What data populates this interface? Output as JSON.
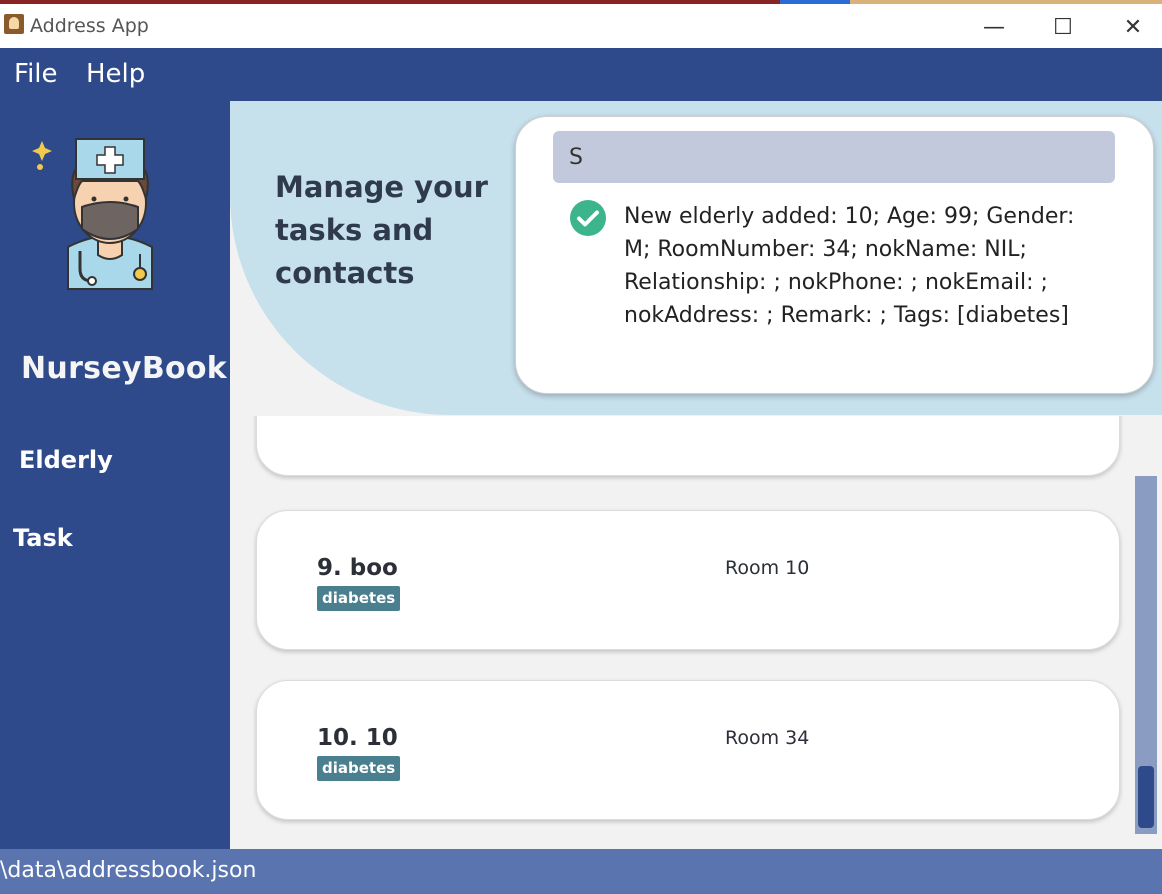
{
  "window": {
    "title": "Address App",
    "minimize_glyph": "—",
    "maximize_glyph": "☐",
    "close_glyph": "✕"
  },
  "menu": {
    "items": [
      {
        "label": "File"
      },
      {
        "label": "Help"
      }
    ]
  },
  "sidebar": {
    "brand": "NurseyBook",
    "avatar_icon": "nurse-avatar-icon",
    "nav": [
      {
        "label": "Elderly"
      },
      {
        "label": "Task"
      }
    ]
  },
  "header": {
    "tagline": "Manage your tasks and contacts"
  },
  "command": {
    "input_value": "S",
    "result_icon": "check-circle-icon",
    "result_text": "New elderly added: 10; Age: 99; Gender: M; RoomNumber: 34; nokName: NIL; Relationship: ; nokPhone: ; nokEmail: ; nokAddress: ; Remark: ; Tags: [diabetes]"
  },
  "elderly_list": [
    {
      "name": "9. boo",
      "tag": "diabetes",
      "room": "Room 10"
    },
    {
      "name": "10. 10",
      "tag": "diabetes",
      "room": "Room 34"
    }
  ],
  "status": {
    "path": "\\data\\addressbook.json"
  },
  "colors": {
    "primary": "#2f4a8a",
    "header_bg": "#c6e0ec",
    "tag_bg": "#4a7f8f",
    "success": "#3cb48c",
    "status_bar": "#5a74b0"
  }
}
